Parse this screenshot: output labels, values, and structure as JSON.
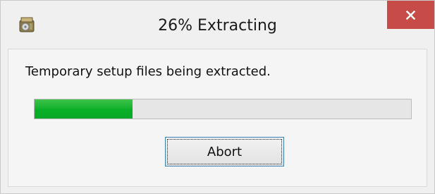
{
  "window": {
    "title": "26% Extracting",
    "app_icon": "setup-package-icon",
    "close_icon": "close-icon",
    "close_color": "#c74c48"
  },
  "dialog": {
    "message": "Temporary setup files being extracted.",
    "progress_percent": 26,
    "progress_color": "#06b025",
    "abort_label": "Abort"
  }
}
